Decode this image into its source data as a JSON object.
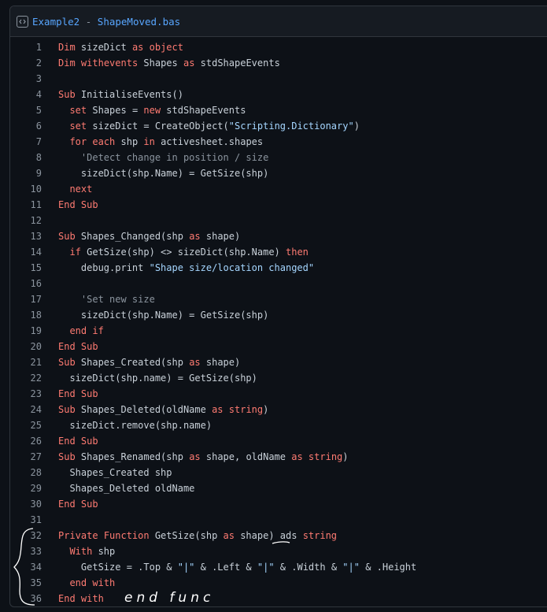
{
  "header": {
    "repo": "Example2",
    "separator": " - ",
    "file": "ShapeMoved.bas",
    "icon": "code-embed-icon"
  },
  "colors": {
    "background": "#0d1117",
    "keyword": "#ff7b72",
    "string": "#a5d6ff",
    "comment": "#8b949e",
    "text": "#c9d1d9",
    "link": "#58a6ff"
  },
  "code": [
    [
      [
        "kw",
        "Dim"
      ],
      [
        "t",
        " sizeDict "
      ],
      [
        "kw",
        "as"
      ],
      [
        "t",
        " "
      ],
      [
        "kw",
        "object"
      ]
    ],
    [
      [
        "kw",
        "Dim"
      ],
      [
        "t",
        " "
      ],
      [
        "kw",
        "withevents"
      ],
      [
        "t",
        " Shapes "
      ],
      [
        "kw",
        "as"
      ],
      [
        "t",
        " stdShapeEvents"
      ]
    ],
    [],
    [
      [
        "kw",
        "Sub"
      ],
      [
        "t",
        " InitialiseEvents()"
      ]
    ],
    [
      [
        "t",
        "  "
      ],
      [
        "kw",
        "set"
      ],
      [
        "t",
        " Shapes = "
      ],
      [
        "kw",
        "new"
      ],
      [
        "t",
        " stdShapeEvents"
      ]
    ],
    [
      [
        "t",
        "  "
      ],
      [
        "kw",
        "set"
      ],
      [
        "t",
        " sizeDict = CreateObject("
      ],
      [
        "s",
        "\"Scripting.Dictionary\""
      ],
      [
        "t",
        ")"
      ]
    ],
    [
      [
        "t",
        "  "
      ],
      [
        "kw",
        "for"
      ],
      [
        "t",
        " "
      ],
      [
        "kw",
        "each"
      ],
      [
        "t",
        " shp "
      ],
      [
        "kw",
        "in"
      ],
      [
        "t",
        " activesheet.shapes"
      ]
    ],
    [
      [
        "t",
        "    "
      ],
      [
        "c",
        "'Detect change in position / size"
      ]
    ],
    [
      [
        "t",
        "    sizeDict(shp.Name) = GetSize(shp)"
      ]
    ],
    [
      [
        "t",
        "  "
      ],
      [
        "kw",
        "next"
      ]
    ],
    [
      [
        "kw",
        "End"
      ],
      [
        "t",
        " "
      ],
      [
        "kw",
        "Sub"
      ]
    ],
    [],
    [
      [
        "kw",
        "Sub"
      ],
      [
        "t",
        " Shapes_Changed(shp "
      ],
      [
        "kw",
        "as"
      ],
      [
        "t",
        " shape)"
      ]
    ],
    [
      [
        "t",
        "  "
      ],
      [
        "kw",
        "if"
      ],
      [
        "t",
        " GetSize(shp) <> sizeDict(shp.Name) "
      ],
      [
        "kw",
        "then"
      ]
    ],
    [
      [
        "t",
        "    debug.print "
      ],
      [
        "s",
        "\"Shape size/location changed\""
      ]
    ],
    [],
    [
      [
        "t",
        "    "
      ],
      [
        "c",
        "'Set new size"
      ]
    ],
    [
      [
        "t",
        "    sizeDict(shp.Name) = GetSize(shp)"
      ]
    ],
    [
      [
        "t",
        "  "
      ],
      [
        "kw",
        "end"
      ],
      [
        "t",
        " "
      ],
      [
        "kw",
        "if"
      ]
    ],
    [
      [
        "kw",
        "End"
      ],
      [
        "t",
        " "
      ],
      [
        "kw",
        "Sub"
      ]
    ],
    [
      [
        "kw",
        "Sub"
      ],
      [
        "t",
        " Shapes_Created(shp "
      ],
      [
        "kw",
        "as"
      ],
      [
        "t",
        " shape)"
      ]
    ],
    [
      [
        "t",
        "  sizeDict(shp.name) = GetSize(shp)"
      ]
    ],
    [
      [
        "kw",
        "End"
      ],
      [
        "t",
        " "
      ],
      [
        "kw",
        "Sub"
      ]
    ],
    [
      [
        "kw",
        "Sub"
      ],
      [
        "t",
        " Shapes_Deleted(oldName "
      ],
      [
        "kw",
        "as"
      ],
      [
        "t",
        " "
      ],
      [
        "kw",
        "string"
      ],
      [
        "t",
        ")"
      ]
    ],
    [
      [
        "t",
        "  sizeDict.remove(shp.name)"
      ]
    ],
    [
      [
        "kw",
        "End"
      ],
      [
        "t",
        " "
      ],
      [
        "kw",
        "Sub"
      ]
    ],
    [
      [
        "kw",
        "Sub"
      ],
      [
        "t",
        " Shapes_Renamed(shp "
      ],
      [
        "kw",
        "as"
      ],
      [
        "t",
        " shape, oldName "
      ],
      [
        "kw",
        "as"
      ],
      [
        "t",
        " "
      ],
      [
        "kw",
        "string"
      ],
      [
        "t",
        ")"
      ]
    ],
    [
      [
        "t",
        "  Shapes_Created shp"
      ]
    ],
    [
      [
        "t",
        "  Shapes_Deleted oldName"
      ]
    ],
    [
      [
        "kw",
        "End"
      ],
      [
        "t",
        " "
      ],
      [
        "kw",
        "Sub"
      ]
    ],
    [],
    [
      [
        "kw",
        "Private"
      ],
      [
        "t",
        " "
      ],
      [
        "kw",
        "Function"
      ],
      [
        "t",
        " GetSize(shp "
      ],
      [
        "kw",
        "as"
      ],
      [
        "t",
        " shape) ads "
      ],
      [
        "kw",
        "string"
      ]
    ],
    [
      [
        "t",
        "  "
      ],
      [
        "kw",
        "With"
      ],
      [
        "t",
        " shp"
      ]
    ],
    [
      [
        "t",
        "    GetSize = .Top & "
      ],
      [
        "s",
        "\"|\""
      ],
      [
        "t",
        " & .Left & "
      ],
      [
        "s",
        "\"|\""
      ],
      [
        "t",
        " & .Width & "
      ],
      [
        "s",
        "\"|\""
      ],
      [
        "t",
        " & .Height"
      ]
    ],
    [
      [
        "t",
        "  "
      ],
      [
        "kw",
        "end"
      ],
      [
        "t",
        " "
      ],
      [
        "kw",
        "with"
      ]
    ],
    [
      [
        "kw",
        "End"
      ],
      [
        "t",
        " "
      ],
      [
        "kw",
        "with"
      ]
    ]
  ],
  "annotations": {
    "note": "end func",
    "icons": [
      "brace-annotation",
      "underline-annotation"
    ]
  }
}
